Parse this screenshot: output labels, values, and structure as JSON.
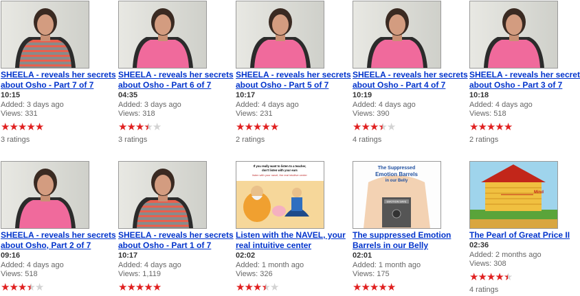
{
  "videos": [
    {
      "title": "SHEELA - reveals her secrets about Osho - Part 7 of 7",
      "duration": "10:15",
      "added": "Added: 3 days ago",
      "views": "Views: 331",
      "rating": 5,
      "ratings": "3 ratings",
      "thumb": "striped"
    },
    {
      "title": "SHEELA - reveals her secrets about Osho - Part 6 of 7",
      "duration": "04:35",
      "added": "Added: 3 days ago",
      "views": "Views: 318",
      "rating": 3.5,
      "ratings": "3 ratings",
      "thumb": "pink"
    },
    {
      "title": "SHEELA - reveals her secrets about Osho - Part 5 of 7",
      "duration": "10:17",
      "added": "Added: 4 days ago",
      "views": "Views: 231",
      "rating": 5,
      "ratings": "2 ratings",
      "thumb": "pink"
    },
    {
      "title": "SHEELA - reveals her secrets about Osho - Part 4 of 7",
      "duration": "10:19",
      "added": "Added: 4 days ago",
      "views": "Views: 390",
      "rating": 3.5,
      "ratings": "4 ratings",
      "thumb": "pink"
    },
    {
      "title": "SHEELA - reveals her secrets about Osho - Part 3 of 7",
      "duration": "10:18",
      "added": "Added: 4 days ago",
      "views": "Views: 518",
      "rating": 5,
      "ratings": "2 ratings",
      "thumb": "pink"
    },
    {
      "title": "SHEELA - reveals her secrets about Osho, Part 2 of 7",
      "duration": "09:16",
      "added": "Added: 4 days ago",
      "views": "Views: 518",
      "rating": 3.5,
      "ratings": "",
      "thumb": "pink"
    },
    {
      "title": "SHEELA - reveals her secrets about Osho - Part 1 of 7",
      "duration": "10:17",
      "added": "Added: 4 days ago",
      "views": "Views: 1,119",
      "rating": 5,
      "ratings": "",
      "thumb": "striped"
    },
    {
      "title": "Listen with the NAVEL, your real intuitive center",
      "duration": "02:02",
      "added": "Added: 1 month ago",
      "views": "Views: 326",
      "rating": 3.5,
      "ratings": "",
      "thumb": "navel",
      "thumb_text": [
        "If you really want to listen to a teacher,",
        "don't listen with your ears",
        "listen with your navel, the real intuitive center"
      ]
    },
    {
      "title": "The suppressed Emotion Barrels in our Belly",
      "duration": "02:01",
      "added": "Added: 1 month ago",
      "views": "Views: 175",
      "rating": 5,
      "ratings": "",
      "thumb": "barrels",
      "thumb_text": [
        "The Suppressed",
        "Emotion Barrels",
        "in our Belly",
        "EMOTION SAFE"
      ]
    },
    {
      "title": "The Pearl of Great Price II",
      "duration": "02:36",
      "added": "Added: 2 months ago",
      "views": "Views: 308",
      "rating": 4.5,
      "ratings": "4 ratings",
      "thumb": "pearl",
      "thumb_text": [
        "Mind"
      ]
    }
  ],
  "colors": {
    "link": "#0033cc",
    "star_on": "#e02020",
    "star_off": "#d3d3d3"
  }
}
